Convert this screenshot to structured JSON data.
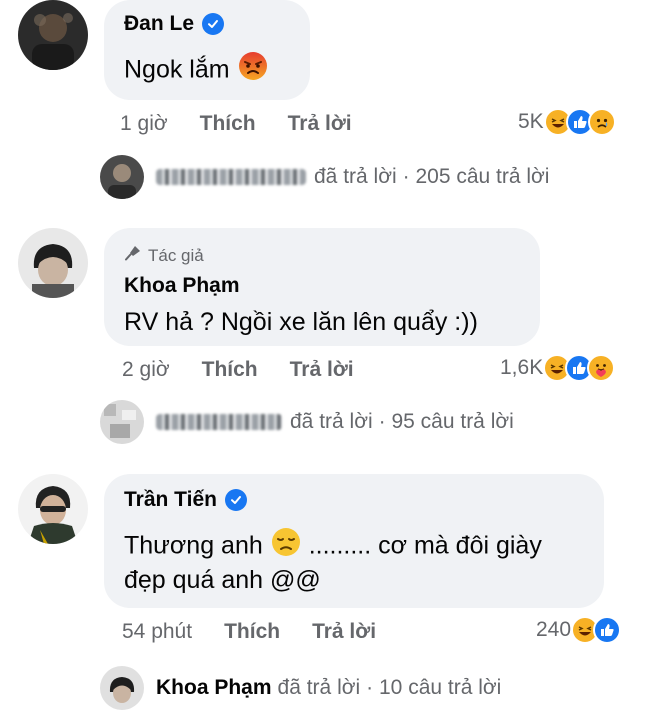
{
  "comments": [
    {
      "author": "Đan Le",
      "verified": true,
      "text": "Ngok lắm",
      "emoji": "angry-face",
      "time": "1 giờ",
      "like_label": "Thích",
      "reply_label": "Trả lời",
      "reaction_count": "5K",
      "reactions": [
        "haha",
        "like",
        "sad"
      ],
      "replies": {
        "replier_blurred": true,
        "replied_label": "đã trả lời",
        "count_label": "· 205 câu trả lời"
      }
    },
    {
      "author": "Khoa Phạm",
      "author_badge": "Tác giả",
      "text": "RV hả ? Ngồi xe lăn lên quẩy :))",
      "time": "2 giờ",
      "like_label": "Thích",
      "reply_label": "Trả lời",
      "reaction_count": "1,6K",
      "reactions": [
        "haha",
        "like",
        "care"
      ],
      "replies": {
        "replier_blurred": true,
        "replied_label": "đã trả lời",
        "count_label": "· 95 câu trả lời"
      }
    },
    {
      "author": "Trần Tiến",
      "verified": true,
      "text_before_emoji": "Thương anh",
      "emoji": "disappointed-face",
      "text_after_emoji": "......... cơ mà đôi giày",
      "text_line2": "đẹp quá anh @@",
      "time": "54 phút",
      "like_label": "Thích",
      "reply_label": "Trả lời",
      "reaction_count": "240",
      "reactions": [
        "haha",
        "like"
      ],
      "replies": {
        "replier_name": "Khoa Phạm",
        "replied_label": "đã trả lời",
        "count_label": "· 10 câu trả lời"
      }
    }
  ],
  "colors": {
    "bubble": "#f0f2f5",
    "meta_text": "#65676b",
    "verified": "#1877f2",
    "like": "#1877f2",
    "haha": "#f7b125"
  }
}
